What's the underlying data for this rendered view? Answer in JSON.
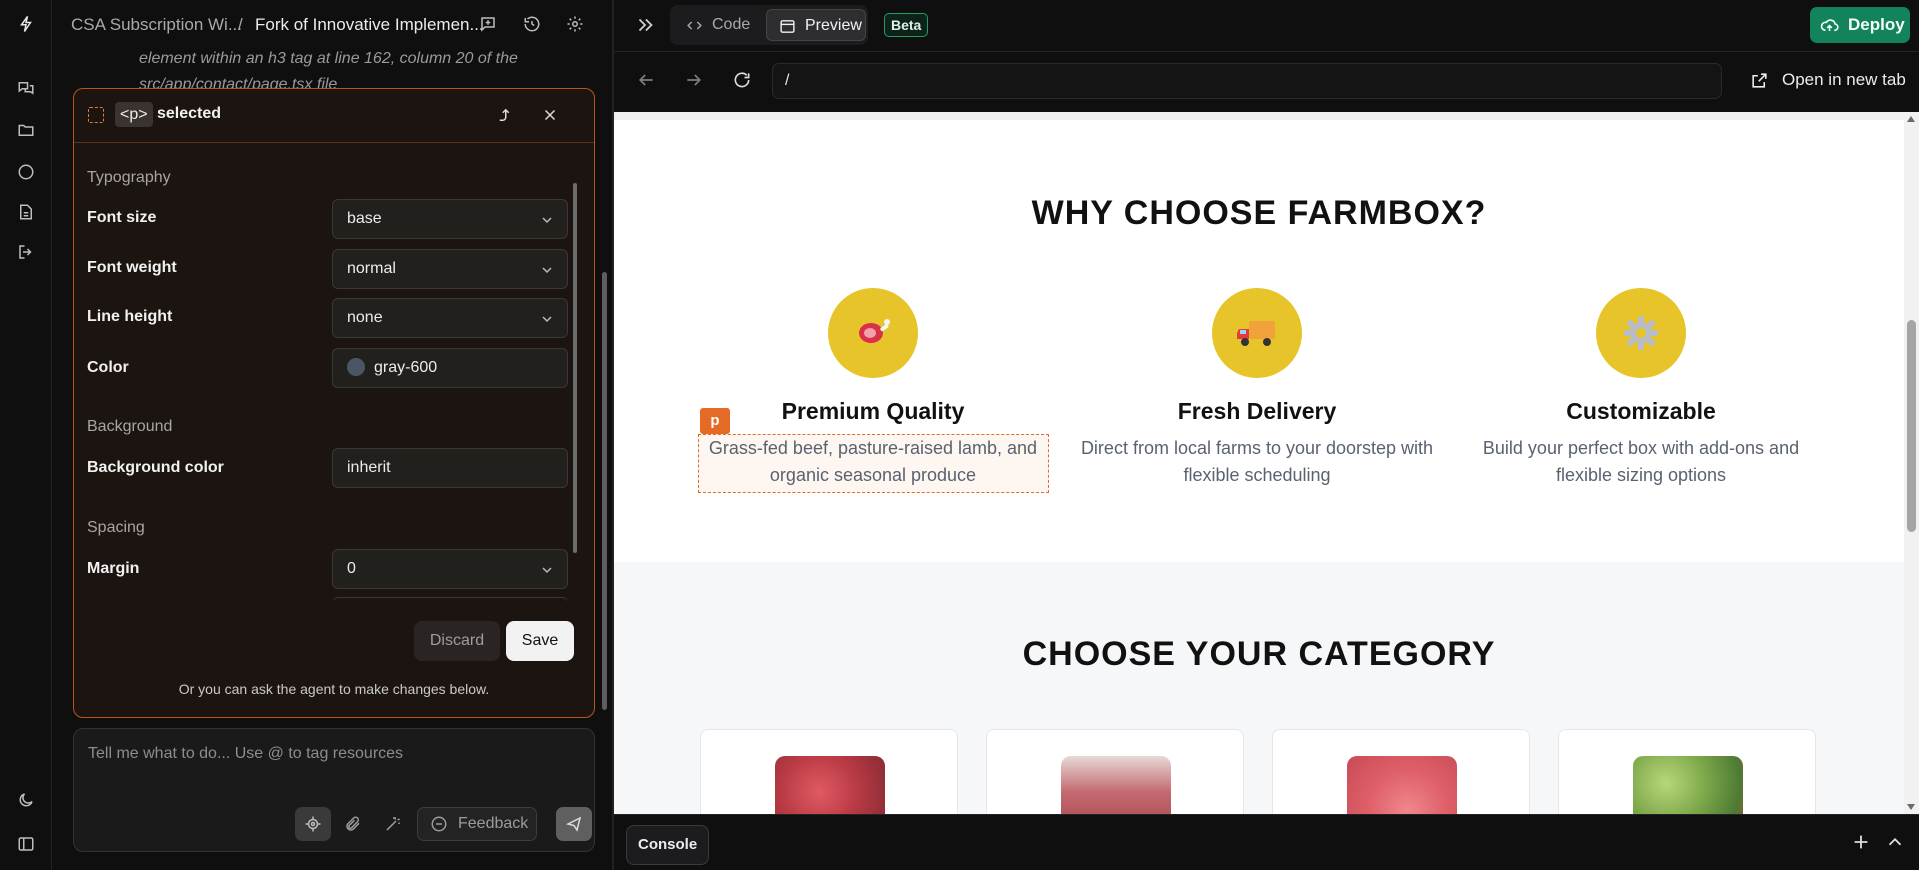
{
  "header": {
    "project_name": "CSA Subscription Wi...",
    "separator": "/",
    "chat_name": "Fork of Innovative Implemen..."
  },
  "chat": {
    "context_text": "element within an h3 tag at line 162, column 20 of the src/app/contact/page.tsx file"
  },
  "inspector": {
    "tag": "<p>",
    "title": "selected",
    "sections": {
      "typography": "Typography",
      "background": "Background",
      "spacing": "Spacing"
    },
    "props": {
      "font_size": {
        "label": "Font size",
        "value": "base"
      },
      "font_weight": {
        "label": "Font weight",
        "value": "normal"
      },
      "line_height": {
        "label": "Line height",
        "value": "none"
      },
      "color": {
        "label": "Color",
        "value": "gray-600"
      },
      "background_color": {
        "label": "Background color",
        "value": "inherit"
      },
      "margin": {
        "label": "Margin",
        "value": "0"
      }
    },
    "discard_label": "Discard",
    "save_label": "Save",
    "hint": "Or you can ask the agent to make changes below."
  },
  "composer": {
    "placeholder": "Tell me what to do... Use @ to tag resources",
    "feedback_label": "Feedback"
  },
  "preview_bar": {
    "code_label": "Code",
    "preview_label": "Preview",
    "beta_label": "Beta",
    "deploy_label": "Deploy",
    "url": "/",
    "open_new_tab": "Open in new tab"
  },
  "site": {
    "why_title": "WHY CHOOSE FARMBOX?",
    "features": [
      {
        "icon": "meat-icon",
        "title": "Premium Quality",
        "desc": "Grass-fed beef, pasture-raised lamb, and organic seasonal produce"
      },
      {
        "icon": "delivery-truck-icon",
        "title": "Fresh Delivery",
        "desc": "Direct from local farms to your doorstep with flexible scheduling"
      },
      {
        "icon": "gear-icon",
        "title": "Customizable",
        "desc": "Build your perfect box with add-ons and flexible sizing options"
      }
    ],
    "selected_badge": "p",
    "category_title": "CHOOSE YOUR CATEGORY"
  },
  "console": {
    "label": "Console"
  },
  "colors": {
    "accent_orange": "#e56a25",
    "deploy_green": "#12835a",
    "feature_yellow": "#e7c52a"
  }
}
